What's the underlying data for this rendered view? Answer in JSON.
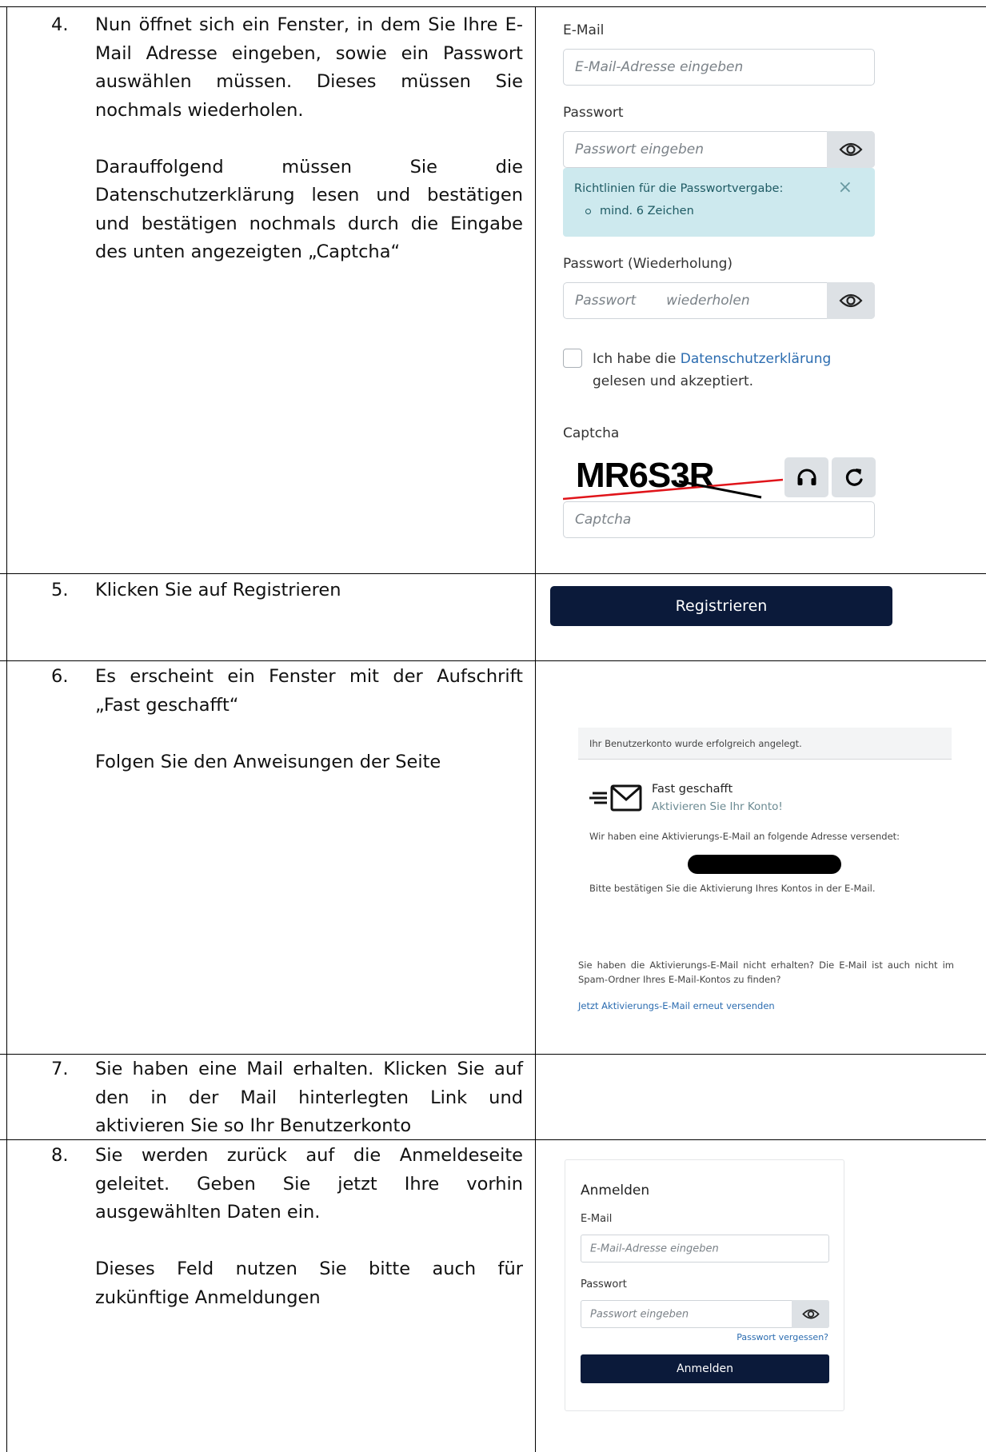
{
  "steps": [
    {
      "num": "4.",
      "paragraphs": [
        "Nun öffnet sich ein Fenster, in dem Sie Ihre E-Mail Adresse eingeben, sowie ein Passwort auswählen müssen. Dieses müssen Sie nochmals wiederholen.",
        "Darauffolgend müssen Sie die Datenschutzerklärung lesen und bestätigen und bestätigen nochmals durch die Eingabe des unten angezeigten „Captcha“"
      ]
    },
    {
      "num": "5.",
      "paragraphs": [
        "Klicken Sie auf Registrieren"
      ]
    },
    {
      "num": "6.",
      "paragraphs": [
        "Es erscheint ein Fenster mit der Aufschrift „Fast geschafft“",
        "Folgen Sie den Anweisungen der Seite"
      ]
    },
    {
      "num": "7.",
      "paragraphs": [
        "Sie haben eine Mail erhalten. Klicken Sie auf den in der Mail hinterlegten Link und aktivieren Sie so Ihr Benutzerkonto"
      ]
    },
    {
      "num": "8.",
      "paragraphs": [
        "Sie werden zurück auf die Anmeldeseite geleitet. Geben Sie jetzt Ihre vorhin ausgewählten Daten ein.",
        "Dieses Feld nutzen Sie bitte auch für zukünftige Anmeldungen"
      ]
    }
  ],
  "registration_form": {
    "email_label": "E-Mail",
    "email_placeholder": "E-Mail-Adresse eingeben",
    "password_label": "Passwort",
    "password_placeholder": "Passwort eingeben",
    "rules_title": "Richtlinien für die Passwortvergabe:",
    "rules_item": "mind. 6 Zeichen",
    "rules_close": "×",
    "password_repeat_label": "Passwort (Wiederholung)",
    "password_repeat_placeholder": "Passwort       wiederholen",
    "consent_prefix": "Ich habe die ",
    "consent_link": "Datenschutzerklärung",
    "consent_suffix": "gelesen und akzeptiert.",
    "captcha_label": "Captcha",
    "captcha_image_text": "MR6S3R",
    "captcha_placeholder": "Captcha",
    "icons": {
      "show_password": "eye-icon",
      "audio_captcha": "headphones-icon",
      "reload_captcha": "refresh-icon"
    }
  },
  "register_button": {
    "label": "Registrieren",
    "color": "#0b1a3a"
  },
  "success_page": {
    "banner": "Ihr Benutzerkonto wurde erfolgreich angelegt.",
    "title": "Fast geschafft",
    "subtitle": "Aktivieren Sie Ihr Konto!",
    "sent_text": "Wir haben eine Aktivierungs-E-Mail an folgende Adresse versendet:",
    "confirm_text": "Bitte bestätigen Sie die Aktivierung Ihres Kontos in der E-Mail.",
    "not_received_text": "Sie haben die Aktivierungs-E-Mail nicht erhalten? Die E-Mail ist auch nicht im Spam-Ordner Ihres E-Mail-Kontos zu finden?",
    "resend_link": "Jetzt Aktivierungs-E-Mail erneut versenden",
    "icon": "mail-send-icon"
  },
  "login_form": {
    "title": "Anmelden",
    "email_label": "E-Mail",
    "email_placeholder": "E-Mail-Adresse eingeben",
    "password_label": "Passwort",
    "password_placeholder": "Passwort eingeben",
    "forgot_link": "Passwort vergessen?",
    "submit_label": "Anmelden"
  }
}
